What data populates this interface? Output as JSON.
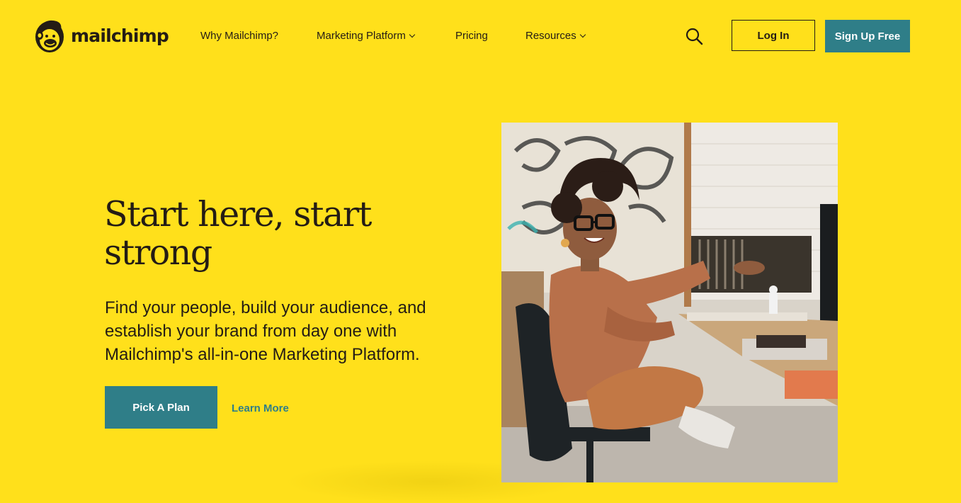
{
  "header": {
    "logo_text": "mailchimp",
    "nav": [
      {
        "label": "Why Mailchimp?",
        "has_dropdown": false
      },
      {
        "label": "Marketing Platform",
        "has_dropdown": true
      },
      {
        "label": "Pricing",
        "has_dropdown": false
      },
      {
        "label": "Resources",
        "has_dropdown": true
      }
    ],
    "search_icon": "search-icon",
    "login_label": "Log In",
    "signup_label": "Sign Up Free"
  },
  "hero": {
    "title": "Start here, start strong",
    "subtitle": "Find your people, build your audience, and establish your brand from day one with Mailchimp's all-in-one Marketing Platform.",
    "primary_cta": "Pick A Plan",
    "secondary_cta": "Learn More",
    "image_alt": "Woman smiling at a desk in an office"
  },
  "colors": {
    "background": "#FFE01B",
    "accent": "#2F7E88",
    "text": "#241C15"
  }
}
